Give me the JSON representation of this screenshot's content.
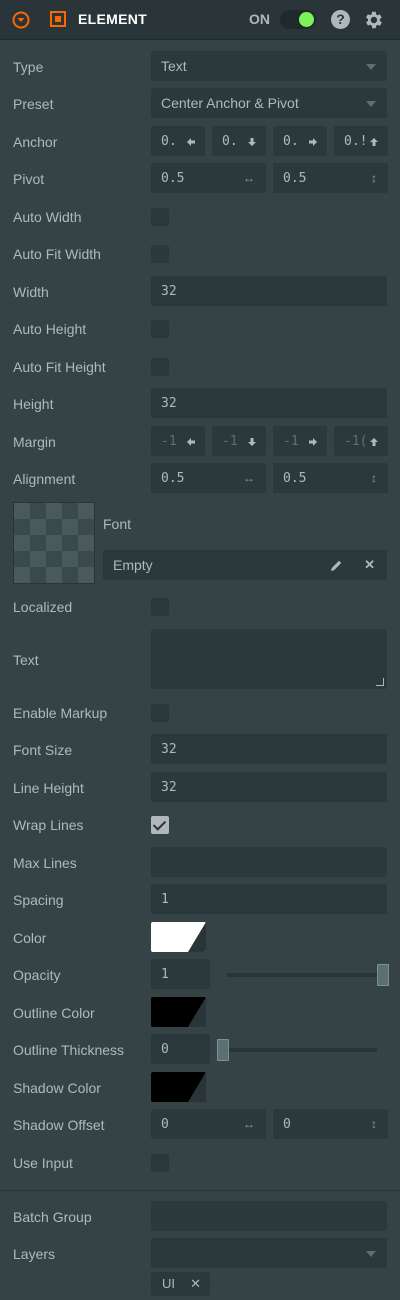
{
  "header": {
    "title": "ELEMENT",
    "toggle_label": "ON",
    "toggle_on": true,
    "help_glyph": "?",
    "icons": [
      "collapse-icon",
      "element-component-icon",
      "help-icon",
      "settings-gear-icon"
    ],
    "accent_color": "#ff6600",
    "toggle_color": "#7df25b"
  },
  "fields": {
    "type": {
      "label": "Type",
      "value": "Text"
    },
    "preset": {
      "label": "Preset",
      "value": "Center Anchor & Pivot"
    },
    "anchor": {
      "label": "Anchor",
      "values": [
        "0.",
        "0.",
        "0.",
        "0.!"
      ],
      "icons": [
        "arrow-left-icon",
        "arrow-down-icon",
        "arrow-right-icon",
        "arrow-up-icon"
      ]
    },
    "pivot": {
      "label": "Pivot",
      "x": "0.5",
      "y": "0.5"
    },
    "auto_width": {
      "label": "Auto Width",
      "checked": false
    },
    "auto_fit_width": {
      "label": "Auto Fit Width",
      "checked": false
    },
    "width": {
      "label": "Width",
      "value": "32"
    },
    "auto_height": {
      "label": "Auto Height",
      "checked": false
    },
    "auto_fit_height": {
      "label": "Auto Fit Height",
      "checked": false
    },
    "height": {
      "label": "Height",
      "value": "32"
    },
    "margin": {
      "label": "Margin",
      "values": [
        "-1",
        "-1",
        "-1",
        "-1("
      ],
      "icons": [
        "arrow-left-icon",
        "arrow-down-icon",
        "arrow-right-icon",
        "arrow-up-icon"
      ]
    },
    "alignment": {
      "label": "Alignment",
      "x": "0.5",
      "y": "0.5"
    },
    "font": {
      "label": "Font",
      "value": "Empty"
    },
    "localized": {
      "label": "Localized",
      "checked": false
    },
    "text": {
      "label": "Text",
      "value": ""
    },
    "enable_markup": {
      "label": "Enable Markup",
      "checked": false
    },
    "font_size": {
      "label": "Font Size",
      "value": "32"
    },
    "line_height": {
      "label": "Line Height",
      "value": "32"
    },
    "wrap_lines": {
      "label": "Wrap Lines",
      "checked": true
    },
    "max_lines": {
      "label": "Max Lines",
      "value": ""
    },
    "spacing": {
      "label": "Spacing",
      "value": "1"
    },
    "color": {
      "label": "Color",
      "swatch": "#ffffff"
    },
    "opacity": {
      "label": "Opacity",
      "value": "1",
      "slider_fraction": 1.0
    },
    "outline_color": {
      "label": "Outline Color",
      "swatch": "#000000"
    },
    "outline_thickness": {
      "label": "Outline Thickness",
      "value": "0",
      "slider_fraction": 0.0
    },
    "shadow_color": {
      "label": "Shadow Color",
      "swatch": "#000000"
    },
    "shadow_offset": {
      "label": "Shadow Offset",
      "x": "0",
      "y": "0"
    },
    "use_input": {
      "label": "Use Input",
      "checked": false
    },
    "batch_group": {
      "label": "Batch Group",
      "value": ""
    },
    "layers": {
      "label": "Layers",
      "value": "",
      "tags": [
        "UI"
      ]
    }
  },
  "glyphs": {
    "horizontal_axis": "↔",
    "vertical_axis": "↕",
    "remove": "✕"
  }
}
